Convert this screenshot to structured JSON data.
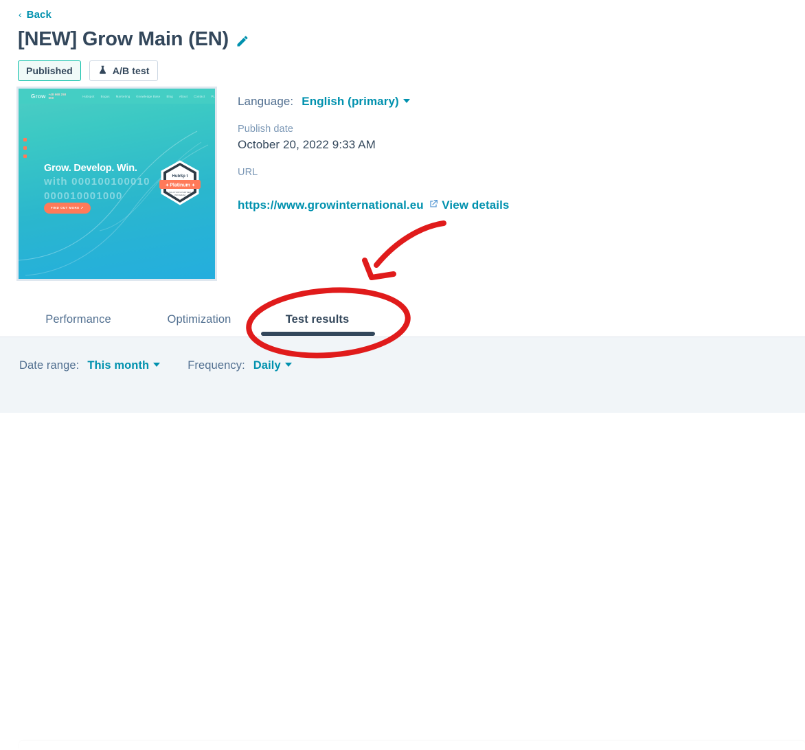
{
  "nav": {
    "back_label": "Back",
    "back_icon": "chevron-left-icon"
  },
  "header": {
    "title": "[NEW] Grow Main (EN)",
    "edit_icon": "pencil-icon",
    "badges": [
      {
        "label": "Published",
        "style": "published",
        "icon": null
      },
      {
        "label": "A/B test",
        "style": "abtest",
        "icon": "flask-icon"
      }
    ]
  },
  "preview": {
    "alt": "page-thumbnail",
    "logo": "Grow",
    "phone": "+48 668 258 500",
    "nav_items": [
      "Hubspot",
      "Bogus",
      "Marketing",
      "Knowledge Base",
      "Blog",
      "About",
      "Contact",
      "PL"
    ],
    "headline": "Grow. Develop. Win.",
    "subheadline_line1": "with 000100100010",
    "subheadline_line2": "000010001000",
    "cta_label": "FIND OUT MORE",
    "badge_brand": "HubSpot",
    "badge_tier": "Platinum",
    "badge_sub": "SOLUTIONS PARTNER PROGRAM"
  },
  "details": {
    "language_label": "Language:",
    "language_value": "English (primary)",
    "publish_date_label": "Publish date",
    "publish_date_value": "October 20, 2022 9:33 AM",
    "url_label": "URL",
    "url_value": "https://www.growinternational.eu",
    "url_icon": "external-link-icon",
    "view_details_label": "View details"
  },
  "tabs": {
    "items": [
      {
        "label": "Performance",
        "active": false
      },
      {
        "label": "Optimization",
        "active": false
      },
      {
        "label": "Test results",
        "active": true
      }
    ]
  },
  "filters": {
    "date_range_label": "Date range:",
    "date_range_value": "This month",
    "frequency_label": "Frequency:",
    "frequency_value": "Daily"
  },
  "annotations": {
    "arrow": "red-curved-arrow",
    "ellipse": "red-ellipse-highlight",
    "color": "#e01b1b"
  },
  "colors": {
    "accent_teal": "#0091ae",
    "navy": "#33475b",
    "muted": "#516f90",
    "published_border": "#00bda5",
    "panel_bg": "#f1f5f8",
    "annotation_red": "#e01b1b"
  }
}
